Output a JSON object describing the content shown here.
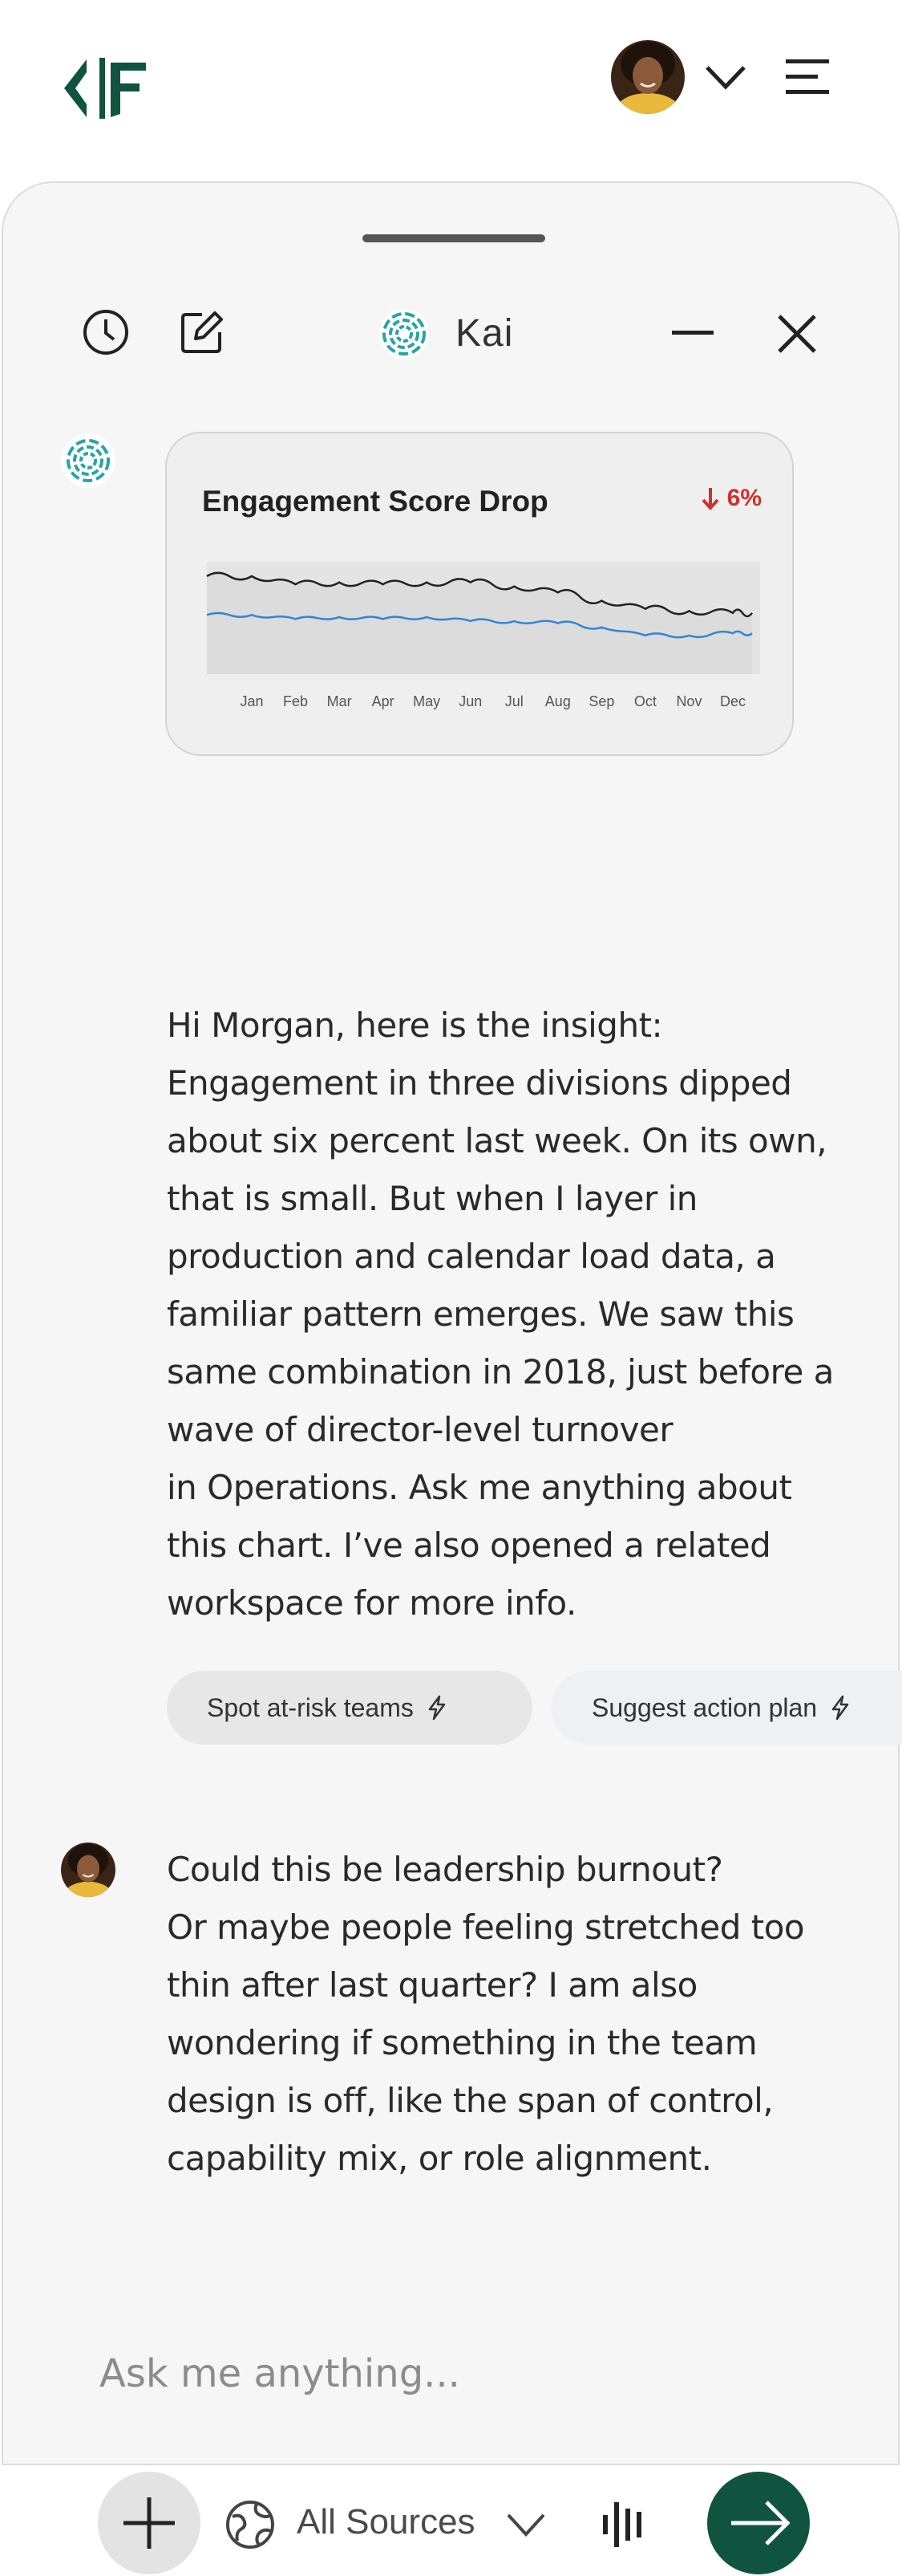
{
  "app": {
    "brand_colors": {
      "primary": "#10543f",
      "teal": "#2aa3a6",
      "negative": "#d0312d"
    },
    "topbar_icons": [
      "brand-logo",
      "user-avatar",
      "chevron-down-icon",
      "hamburger-menu-icon"
    ]
  },
  "panel": {
    "assistant_name": "Kai",
    "header_icons": [
      "history-icon",
      "compose-icon",
      "kai-logo-icon",
      "minimize-icon",
      "close-icon"
    ]
  },
  "conversation": {
    "chart_card": {
      "title": "Engagement Score Drop",
      "change": "6%",
      "change_direction": "down",
      "chart_data": {
        "type": "line",
        "x": [
          "Jan",
          "Feb",
          "Mar",
          "Apr",
          "May",
          "Jun",
          "Jul",
          "Aug",
          "Sep",
          "Oct",
          "Nov",
          "Dec"
        ],
        "series": [
          {
            "color": "#222222",
            "values": [
              74,
              70,
              71,
              70,
              71,
              71,
              69,
              66,
              62,
              58,
              57,
              56
            ]
          },
          {
            "color": "#2f86d6",
            "values": [
              55,
              53,
              54,
              53,
              54,
              52,
              52,
              51,
              49,
              45,
              45,
              46
            ]
          }
        ],
        "ylim": [
          30,
          85
        ],
        "grid": false,
        "legend": "none"
      }
    },
    "assistant_message_lines": [
      "Hi Morgan, here is the insight:",
      "Engagement in three divisions dipped",
      "about six percent last week. On its own,",
      "that is small. But when I layer in",
      "production and calendar load data, a",
      "familiar pattern emerges. We saw this",
      "same combination in 2018, just before a",
      "wave of director-level turnover",
      "in Operations. Ask me anything about",
      "this chart. I’ve also opened a related",
      "workspace for more info."
    ],
    "suggestions": [
      {
        "label": "Spot at-risk teams",
        "icon": "lightning-icon"
      },
      {
        "label": "Suggest action plan",
        "icon": "lightning-icon"
      }
    ],
    "user_message_lines": [
      "Could this be leadership burnout?",
      "Or maybe people feeling stretched too",
      "thin after last quarter? I am also",
      "wondering if something in the team",
      "design is off, like the span of control,",
      "capability mix, or role alignment."
    ]
  },
  "composer": {
    "placeholder": "Ask me anything...",
    "sources_label": "All Sources",
    "icons": [
      "plus-icon",
      "globe-icon",
      "chevron-down-icon",
      "voice-waveform-icon",
      "arrow-right-icon"
    ]
  }
}
